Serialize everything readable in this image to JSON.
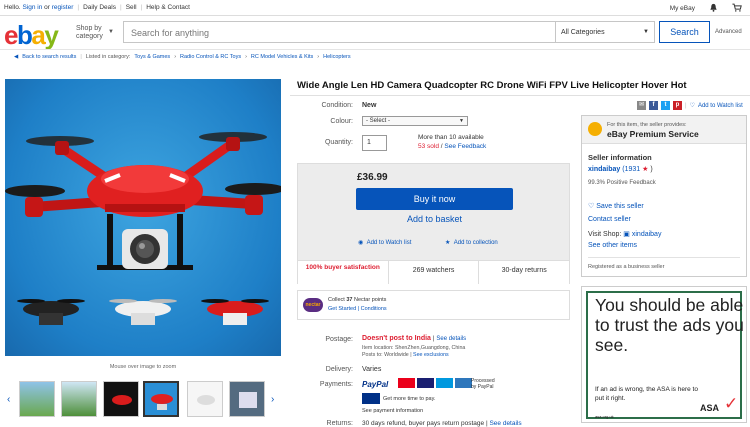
{
  "topbar": {
    "hello": "Hello.",
    "sign_in": "Sign in",
    "or": "or",
    "register": "register",
    "daily_deals": "Daily Deals",
    "sell": "Sell",
    "help": "Help & Contact",
    "my_ebay": "My eBay"
  },
  "header": {
    "logo": [
      "e",
      "b",
      "a",
      "y"
    ],
    "shop_by": "Shop by",
    "category": "category",
    "search_placeholder": "Search for anything",
    "all_categories": "All Categories",
    "search_button": "Search",
    "advanced": "Advanced"
  },
  "breadcrumb": {
    "back": "Back to search results",
    "listed_in": "Listed in category:",
    "items": [
      "Toys & Games",
      "Radio Control & RC Toys",
      "RC Model Vehicles & Kits",
      "Helicopters"
    ]
  },
  "gallery": {
    "zoom_hint": "Mouse over image to zoom"
  },
  "listing": {
    "title": "Wide Angle Len HD Camera Quadcopter RC Drone WiFi FPV Live Helicopter Hover Hot",
    "condition_label": "Condition:",
    "condition": "New",
    "colour_label": "Colour:",
    "colour_select": "- Select -",
    "quantity_label": "Quantity:",
    "quantity": "1",
    "available": "More than 10 available",
    "sold": "53 sold",
    "see_feedback": "See Feedback",
    "price": "£36.99",
    "buy_now": "Buy it now",
    "add_to_basket": "Add to basket",
    "add_watch": "Add to Watch list",
    "add_collection": "Add to collection",
    "satisfaction": "100% buyer satisfaction",
    "watchers": "269 watchers",
    "returns": "30-day returns",
    "nectar_logo": "nectar",
    "nectar_collect": "Collect",
    "nectar_points": "37",
    "nectar_suffix": "Nectar points",
    "nectar_get": "Get Started",
    "nectar_conditions": "Conditions",
    "postage_label": "Postage:",
    "postage": "Doesn't post to India",
    "see_details": "See details",
    "location": "Item location:  ShenZhen,Guangdong, China",
    "posts_to": "Posts to:  Worldwide",
    "see_exclusions": "See exclusions",
    "delivery_label": "Delivery:",
    "delivery": "Varies",
    "payments_label": "Payments:",
    "paypal": "PayPal",
    "processed_by": "Processed by PayPal",
    "credit_text": "Get more time to pay.",
    "see_payment": "See payment information",
    "returns_label": "Returns:",
    "returns_text": "30 days refund, buyer pays return postage |",
    "see_details2": "See details"
  },
  "share": {
    "watch_list": "Add to Watch list"
  },
  "seller": {
    "provides": "For this item, the seller provides:",
    "premium": "eBay Premium Service",
    "info_title": "Seller information",
    "name": "xindaibay",
    "score": "1931",
    "positive": "99.3% Positive Feedback",
    "save": "Save this seller",
    "contact": "Contact seller",
    "visit_shop": "Visit Shop:",
    "shop_name": "xindaibay",
    "see_other": "See other items",
    "registered": "Registered as a business seller"
  },
  "ad": {
    "headline": "You should be able to trust the ads you see.",
    "body": "If an ad is wrong, the ASA is here to put it right.",
    "brand": "ASA",
    "url": "asa.org.uk"
  },
  "colors": {
    "accent": "#0654ba",
    "red": "#dd1e31"
  }
}
